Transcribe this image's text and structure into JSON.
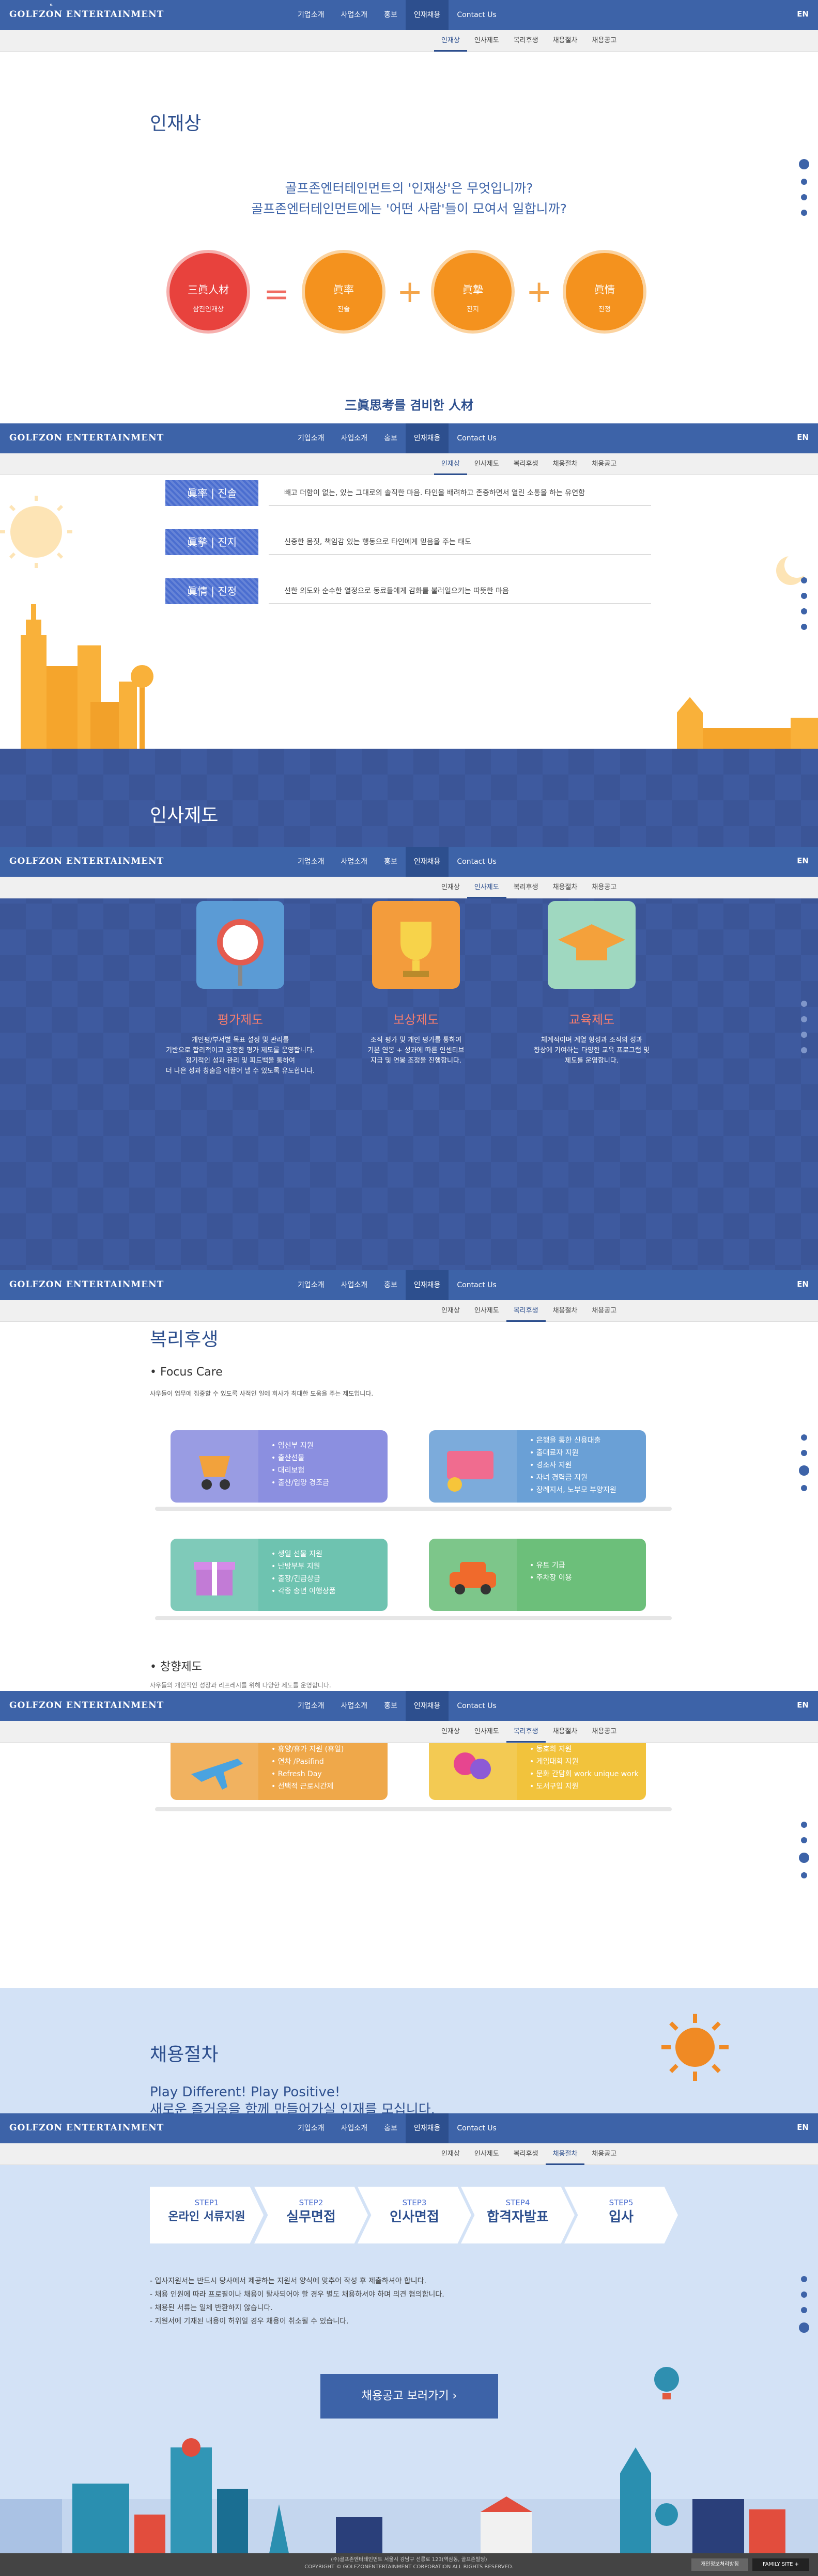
{
  "nav": {
    "logo": "GOLFZON ENTERTAINMENT",
    "menu": [
      "기업소개",
      "사업소개",
      "홍보",
      "인재채용",
      "Contact Us"
    ],
    "lang": "EN"
  },
  "subnav": [
    "인재상",
    "인사제도",
    "복리후생",
    "채용절차",
    "채용공고"
  ],
  "talent": {
    "title": "인재상",
    "question1": "골프존엔터테인먼트의 '인재상'은 무엇입니까?",
    "question2": "골프존엔터테인먼트에는 '어떤 사람'들이 모여서 일합니까?",
    "circle_main": {
      "title": "三眞人材",
      "sub": "삼진인재상"
    },
    "equals": "=",
    "plus": "+",
    "circles": [
      {
        "title": "眞率",
        "sub": "진솔"
      },
      {
        "title": "眞摯",
        "sub": "진지"
      },
      {
        "title": "眞情",
        "sub": "진정"
      }
    ],
    "bottom_title": "三眞思考를 겸비한 人材",
    "traits": [
      {
        "tag": "眞率 | 진솔",
        "desc": "빼고 더함이 없는, 있는 그대로의 솔직한 마음. 타인을 배려하고 존중하면서 열린 소통을 하는 유연함"
      },
      {
        "tag": "眞摯 | 진지",
        "desc": "신중한 몸짓, 책임감 있는 행동으로 타인에게 믿음을 주는 태도"
      },
      {
        "tag": "眞情 | 진정",
        "desc": "선한 의도와 순수한 열정으로 동료들에게 감화를 불러일으키는 따뜻한 마음"
      }
    ]
  },
  "hr": {
    "title": "인사제도",
    "items": [
      {
        "title": "평가제도",
        "text": [
          "개인평/부서별 목표 설정 및 관리를",
          "기반으로 합리적이고 공정한 평가 제도를 운영합니다.",
          "정기적인 성과 관리 및 피드백을 통하여",
          "더 나은 성과 창출을 이끌어 낼 수 있도록 유도합니다."
        ]
      },
      {
        "title": "보상제도",
        "text": [
          "조직 평가 및 개인 평가를 통하여",
          "기본 연봉 + 성과에 따른 인센티브",
          "지급 및 연봉 조정을 진행합니다."
        ]
      },
      {
        "title": "교육제도",
        "text": [
          "체계적이며 계열 형성과 조직의 성과",
          "향상에 기여하는 다양한 교육 프로그램 및",
          "제도를 운영합니다."
        ]
      }
    ]
  },
  "welfare": {
    "title": "복리후생",
    "focus_title": "• Focus Care",
    "focus_desc": "사우들이 업무에 집중할 수 있도록 사적인 일에 회사가 최대한 도움을 주는 제도입니다.",
    "cards": [
      {
        "items": [
          "임신부 지원",
          "출산선물",
          "대리보험",
          "출산/입양 경조금"
        ]
      },
      {
        "items": [
          "은행을 통한 신용대출",
          "출대료자 지원",
          "경조사 지원",
          "자녀 경력금 지원",
          "장례지서, 노부모 부양지원"
        ]
      },
      {
        "items": [
          "생일 선물 지원",
          "난방부부 지원",
          "출장/긴급상금",
          "각종 송년 여행상품"
        ]
      },
      {
        "items": [
          "유트 기급",
          "주차장 이용"
        ]
      }
    ],
    "growth_title": "• 창향제도",
    "growth_desc": "사우들의 개인적인 성장과 리프레시를 위해 다양한 제도를 운영합니다.",
    "cards2": [
      {
        "items": [
          "휴양/휴가 지원 (휴일)",
          "연차 /Pasifind",
          "Refresh Day",
          "선택적 근로시간제"
        ]
      },
      {
        "items": [
          "동호회 지원",
          "게임대회 지원",
          "문화 간담회 work unique work",
          "도서구입 지원"
        ]
      }
    ]
  },
  "process": {
    "title": "채용절차",
    "slogan1": "Play Different! Play Positive!",
    "slogan2": "새로운 즐거움을 함께 만들어가실 인재를 모십니다.",
    "steps": [
      {
        "num": "STEP1",
        "label": "온라인 서류지원"
      },
      {
        "num": "STEP2",
        "label": "실무면접"
      },
      {
        "num": "STEP3",
        "label": "인사면접"
      },
      {
        "num": "STEP4",
        "label": "합격자발표"
      },
      {
        "num": "STEP5",
        "label": "입사"
      }
    ],
    "notes": [
      "- 입사지원서는 반드시 당사에서 제공하는 지원서 양식에 맞추어 작성 후 제출하셔야 합니다.",
      "- 채용 인원에 따라 프로필이나 채용이 탈사되어야 할 경우 별도 채용하셔야 하며 의견 협의합니다.",
      "- 채용된 서류는 일체 반환하지 않습니다.",
      "- 지원서에 기재된 내용이 허위일 경우 채용이 취소될 수 있습니다."
    ],
    "cta": "채용공고 보러가기  ›"
  },
  "footer": {
    "line1": "(주)골프존엔터테인먼트 서울시 강남구 선릉로 123(역삼동, 골프존빌딩)",
    "line2": "COPYRIGHT © GOLFZONENTERTAINMENT CORPORATION ALL RIGHTS RESERVED.",
    "btn_privacy": "개인정보처리방침",
    "btn_family": "FAMILY SITE  +"
  }
}
